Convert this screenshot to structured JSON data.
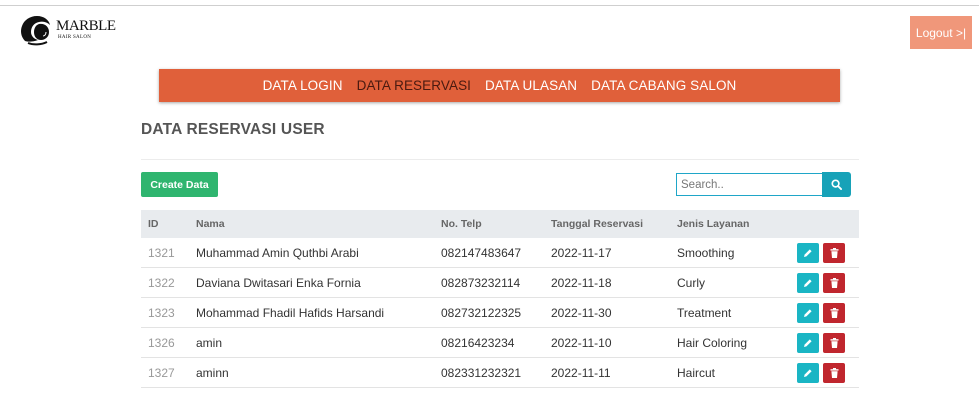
{
  "brand": {
    "name": "MARBLE",
    "sub": "HAIR SALON"
  },
  "header": {
    "logout_label": "Logout >|"
  },
  "nav": {
    "items": [
      {
        "label": "DATA LOGIN"
      },
      {
        "label": "DATA RESERVASI"
      },
      {
        "label": "DATA ULASAN"
      },
      {
        "label": "DATA CABANG SALON"
      }
    ],
    "active_index": 1
  },
  "page": {
    "title": "DATA RESERVASI USER"
  },
  "toolbar": {
    "create_label": "Create Data",
    "search_placeholder": "Search.."
  },
  "table": {
    "headers": [
      "ID",
      "Nama",
      "No. Telp",
      "Tanggal Reservasi",
      "Jenis Layanan"
    ],
    "rows": [
      {
        "id": "1321",
        "nama": "Muhammad Amin Quthbi Arabi",
        "telp": "082147483647",
        "tanggal": "2022-11-17",
        "jenis": "Smoothing"
      },
      {
        "id": "1322",
        "nama": "Daviana Dwitasari Enka Fornia",
        "telp": "082873232114",
        "tanggal": "2022-11-18",
        "jenis": "Curly"
      },
      {
        "id": "1323",
        "nama": "Mohammad Fhadil Hafids Harsandi",
        "telp": "082732122325",
        "tanggal": "2022-11-30",
        "jenis": "Treatment"
      },
      {
        "id": "1326",
        "nama": "amin",
        "telp": "08216423234",
        "tanggal": "2022-11-10",
        "jenis": "Hair Coloring"
      },
      {
        "id": "1327",
        "nama": "aminn",
        "telp": "082331232321",
        "tanggal": "2022-11-11",
        "jenis": "Haircut"
      }
    ]
  },
  "icons": {
    "edit": "pencil-icon",
    "delete": "trash-icon",
    "search": "search-icon"
  },
  "colors": {
    "nav": "#e0603a",
    "logout": "#f0977a",
    "create": "#2fb56f",
    "edit": "#1ab5c4",
    "delete": "#c0262e",
    "search": "#17a2b8"
  }
}
